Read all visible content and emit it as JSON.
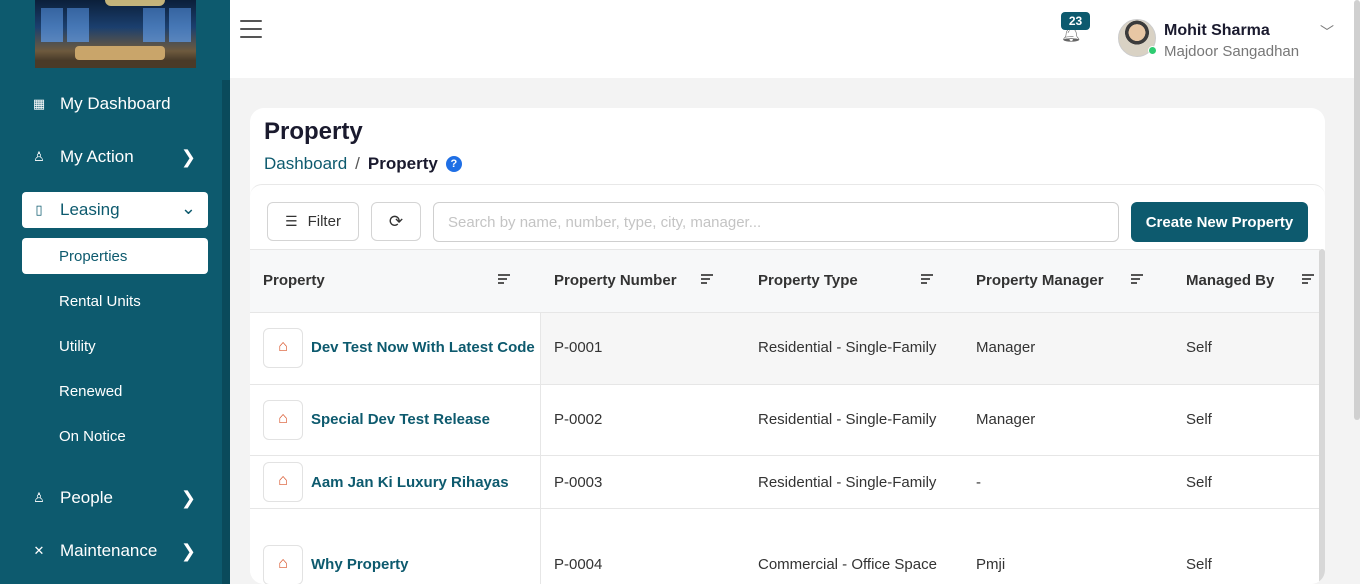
{
  "sidebar": {
    "items": [
      {
        "label": "My Dashboard"
      },
      {
        "label": "My Action"
      },
      {
        "label": "Leasing"
      },
      {
        "label": "People"
      },
      {
        "label": "Maintenance"
      }
    ],
    "leasing_sub": [
      {
        "label": "Properties"
      },
      {
        "label": "Rental Units"
      },
      {
        "label": "Utility"
      },
      {
        "label": "Renewed"
      },
      {
        "label": "On Notice"
      }
    ]
  },
  "header": {
    "notification_count": "23",
    "user_name": "Mohit Sharma",
    "user_org": "Majdoor Sangadhan"
  },
  "page": {
    "title": "Property",
    "breadcrumb": {
      "home": "Dashboard",
      "sep": "/",
      "current": "Property",
      "help": "?"
    }
  },
  "toolbar": {
    "filter_label": "Filter",
    "search_placeholder": "Search by name, number, type, city, manager...",
    "create_label": "Create New Property"
  },
  "table": {
    "columns": [
      "Property",
      "Property Number",
      "Property Type",
      "Property Manager",
      "Managed By"
    ],
    "rows": [
      {
        "name": "Dev Test Now With Latest Code",
        "number": "P-0001",
        "type": "Residential - Single-Family",
        "manager": "Manager",
        "managed_by": "Self"
      },
      {
        "name": "Special Dev Test Release",
        "number": "P-0002",
        "type": "Residential - Single-Family",
        "manager": "Manager",
        "managed_by": "Self"
      },
      {
        "name": "Aam Jan Ki Luxury Rihayas",
        "number": "P-0003",
        "type": "Residential - Single-Family",
        "manager": "-",
        "managed_by": "Self"
      },
      {
        "name": "Why Property",
        "number": "P-0004",
        "type": "Commercial - Office Space",
        "manager": "Pmji",
        "managed_by": "Self"
      }
    ]
  },
  "colors": {
    "brand": "#0d5a6e",
    "help": "#1f6fe5",
    "online": "#2ecc71"
  }
}
